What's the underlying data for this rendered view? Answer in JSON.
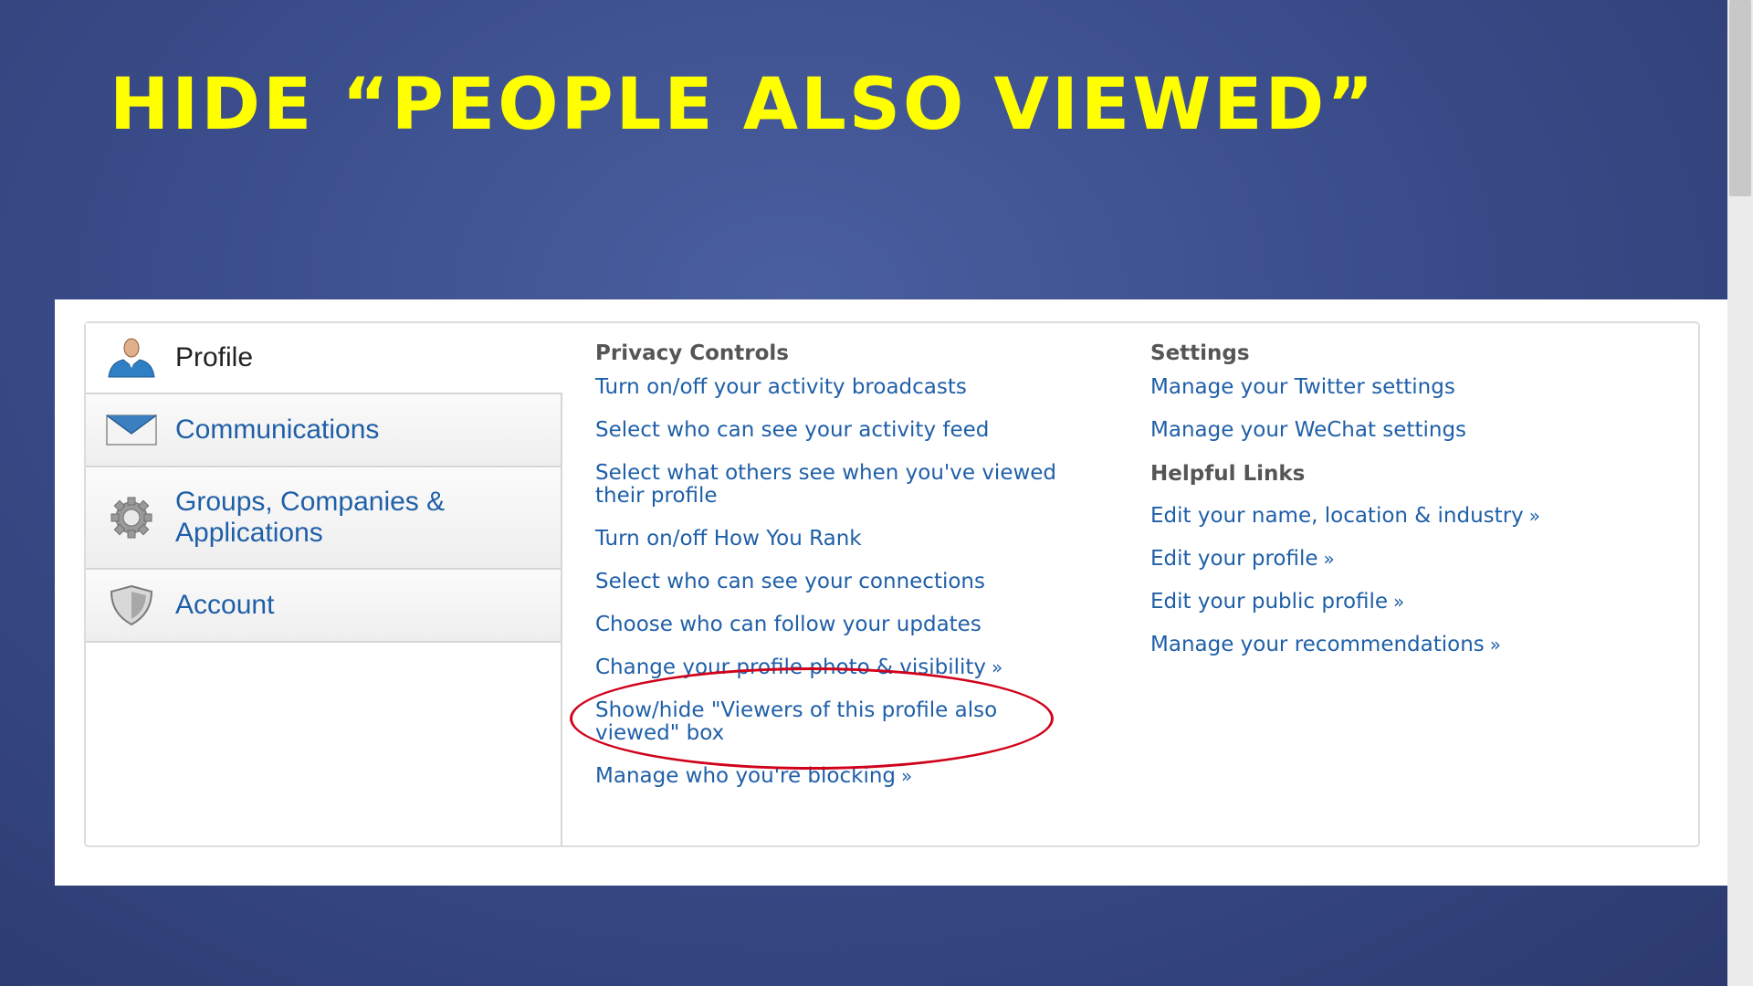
{
  "slide": {
    "title": "HIDE “PEOPLE ALSO VIEWED”",
    "title_color": "#ffff00"
  },
  "sidebar": {
    "items": [
      {
        "label": "Profile",
        "icon": "user-icon",
        "active": true
      },
      {
        "label": "Communications",
        "icon": "envelope-icon",
        "active": false
      },
      {
        "label": "Groups, Companies &",
        "label2": "Applications",
        "icon": "gear-icon",
        "active": false
      },
      {
        "label": "Account",
        "icon": "shield-icon",
        "active": false
      }
    ]
  },
  "privacy": {
    "title": "Privacy Controls",
    "links": [
      {
        "line1": "Turn on/off your activity broadcasts"
      },
      {
        "line1": "Select who can see your activity feed"
      },
      {
        "line1": "Select what others see when you've viewed",
        "line2": "their profile"
      },
      {
        "line1": "Turn on/off How You Rank"
      },
      {
        "line1": "Select who can see your connections"
      },
      {
        "line1": "Choose who can follow your updates"
      },
      {
        "line1": "Change your profile photo & visibility",
        "arrow": "»"
      },
      {
        "line1": "Show/hide \"Viewers of this profile also",
        "line2": "viewed\" box"
      },
      {
        "line1": "Manage who you're blocking",
        "arrow": "»"
      }
    ]
  },
  "settings": {
    "title": "Settings",
    "links": [
      {
        "label": "Manage your Twitter settings"
      },
      {
        "label": "Manage your WeChat settings"
      }
    ],
    "helpful_title": "Helpful Links",
    "helpful_links": [
      {
        "label": "Edit your name, location & industry",
        "arrow": "»"
      },
      {
        "label": "Edit your profile",
        "arrow": "»"
      },
      {
        "label": "Edit your public profile",
        "arrow": "»"
      },
      {
        "label": "Manage your recommendations",
        "arrow": "»"
      }
    ]
  },
  "colors": {
    "link": "#1f5fa8",
    "highlight": "#d0021b",
    "background": "#3a4c8a"
  }
}
